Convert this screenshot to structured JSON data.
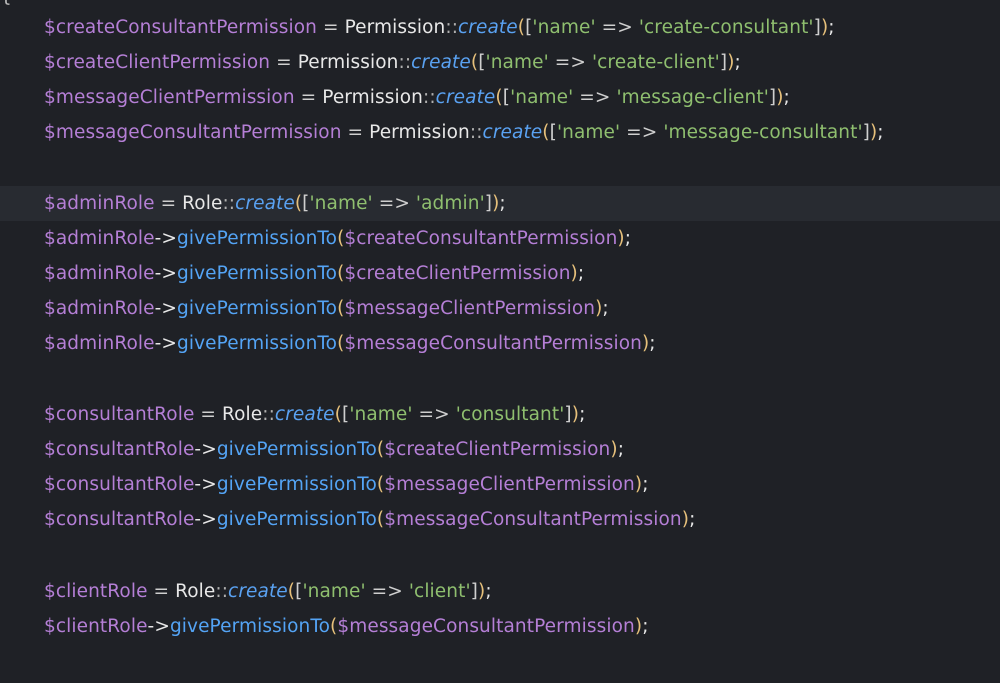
{
  "editor": {
    "brace": "{",
    "lines": [
      {
        "id": "perm-create-consultant",
        "var": "$createConsultantPermission",
        "cls": "Permission",
        "fn": "create",
        "key": "'name'",
        "arrow": "=>",
        "val": "'create-consultant'"
      },
      {
        "id": "perm-create-client",
        "var": "$createClientPermission",
        "cls": "Permission",
        "fn": "create",
        "key": "'name'",
        "arrow": "=>",
        "val": "'create-client'"
      },
      {
        "id": "perm-message-client",
        "var": "$messageClientPermission",
        "cls": "Permission",
        "fn": "create",
        "key": "'name'",
        "arrow": "=>",
        "val": "'message-client'"
      },
      {
        "id": "perm-message-consultant",
        "var": "$messageConsultantPermission",
        "cls": "Permission",
        "fn": "create",
        "key": "'name'",
        "arrow": "=>",
        "val": "'message-consultant'"
      },
      {
        "id": "admin-role",
        "var": "$adminRole",
        "cls": "Role",
        "fn": "create",
        "key": "'name'",
        "arrow": "=>",
        "val": "'admin'"
      },
      {
        "id": "admin-give-1",
        "obj": "$adminRole",
        "op": "->",
        "method": "givePermissionTo",
        "arg": "$createConsultantPermission"
      },
      {
        "id": "admin-give-2",
        "obj": "$adminRole",
        "op": "->",
        "method": "givePermissionTo",
        "arg": "$createClientPermission"
      },
      {
        "id": "admin-give-3",
        "obj": "$adminRole",
        "op": "->",
        "method": "givePermissionTo",
        "arg": "$messageClientPermission"
      },
      {
        "id": "admin-give-4",
        "obj": "$adminRole",
        "op": "->",
        "method": "givePermissionTo",
        "arg": "$messageConsultantPermission"
      },
      {
        "id": "consultant-role",
        "var": "$consultantRole",
        "cls": "Role",
        "fn": "create",
        "key": "'name'",
        "arrow": "=>",
        "val": "'consultant'"
      },
      {
        "id": "consultant-give-1",
        "obj": "$consultantRole",
        "op": "->",
        "method": "givePermissionTo",
        "arg": "$createClientPermission"
      },
      {
        "id": "consultant-give-2",
        "obj": "$consultantRole",
        "op": "->",
        "method": "givePermissionTo",
        "arg": "$messageClientPermission"
      },
      {
        "id": "consultant-give-3",
        "obj": "$consultantRole",
        "op": "->",
        "method": "givePermissionTo",
        "arg": "$messageConsultantPermission"
      },
      {
        "id": "client-role",
        "var": "$clientRole",
        "cls": "Role",
        "fn": "create",
        "key": "'name'",
        "arrow": "=>",
        "val": "'client'"
      },
      {
        "id": "client-give-1",
        "obj": "$clientRole",
        "op": "->",
        "method": "givePermissionTo",
        "arg": "$messageConsultantPermission"
      }
    ]
  }
}
